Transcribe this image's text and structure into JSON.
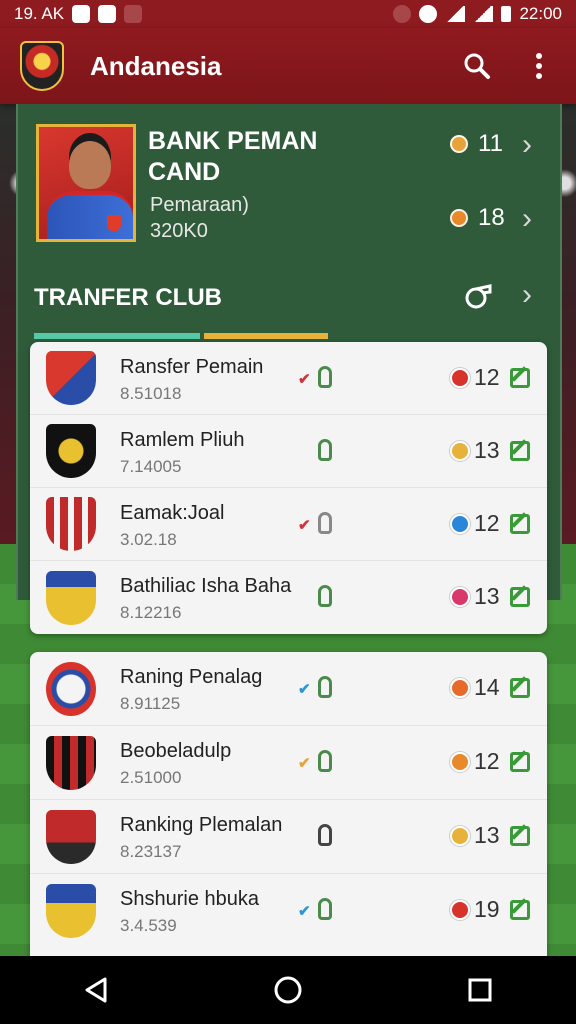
{
  "status_bar": {
    "time_left": "19. AK",
    "time_right": "22:00"
  },
  "app_bar": {
    "title": "Andanesia",
    "search_icon": "search-icon",
    "menu_icon": "more-vert-icon"
  },
  "player_card": {
    "title": "BANK PEMAN CAND",
    "subtitle": "Pemaraan)",
    "code": "320K0",
    "stats": [
      {
        "value": "11",
        "color": "#e8a23a"
      },
      {
        "value": "18",
        "color": "#e8892a"
      }
    ]
  },
  "section": {
    "title": "TRANFER CLUB",
    "icon": "whistle-icon"
  },
  "list1": [
    {
      "name": "Ransfer Pemain",
      "code": "8.51018",
      "mark": "✔",
      "mark_color": "#d0343a",
      "dot_color": "#d8332a",
      "value": "12",
      "lock": "green"
    },
    {
      "name": "Ramlem Pliuh",
      "code": "7.14005",
      "mark": "",
      "mark_color": "",
      "dot_color": "#e8b23a",
      "value": "13",
      "lock": "green"
    },
    {
      "name": "Eamak:Joal",
      "code": "3.02.18",
      "mark": "✔",
      "mark_color": "#d0343a",
      "dot_color": "#2a86d8",
      "value": "12",
      "lock": "gray"
    },
    {
      "name": "Bathiliac Isha Baha",
      "code": "8.12216",
      "mark": "",
      "mark_color": "",
      "dot_color": "#d8386a",
      "value": "13",
      "lock": "green"
    }
  ],
  "list2": [
    {
      "name": "Raning Penalag",
      "code": "8.91125",
      "mark": "✔",
      "mark_color": "#2a96d8",
      "dot_color": "#e86a2a",
      "value": "14",
      "lock": "green"
    },
    {
      "name": "Beobeladulp",
      "code": "2.51000",
      "mark": "✔",
      "mark_color": "#e8a23a",
      "dot_color": "#e8892a",
      "value": "12",
      "lock": "green"
    },
    {
      "name": "Ranking Plemalan",
      "code": "8.23137",
      "mark": "",
      "mark_color": "",
      "dot_color": "#e8b23a",
      "value": "13",
      "lock": "dark"
    },
    {
      "name": "Shshurie hbuka",
      "code": "3.4.539",
      "mark": "✔",
      "mark_color": "#2a96d8",
      "dot_color": "#d8332a",
      "value": "19",
      "lock": "green"
    }
  ]
}
